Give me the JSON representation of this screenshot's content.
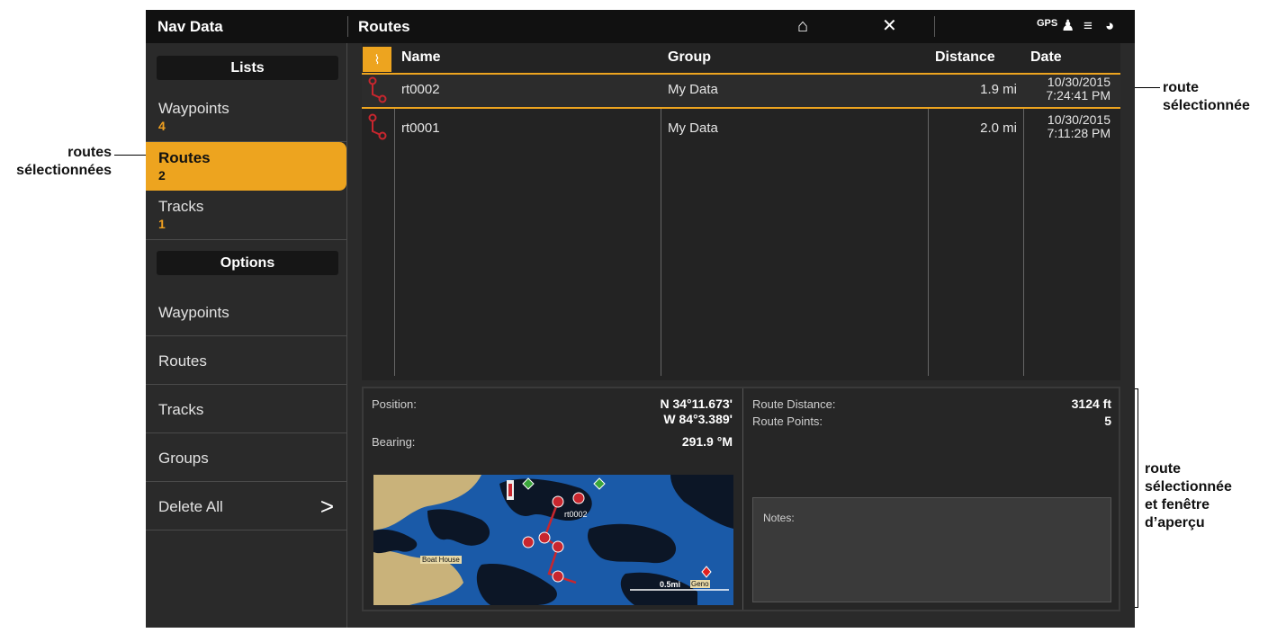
{
  "topbar": {
    "left_title": "Nav Data",
    "center_title": "Routes",
    "gps_label": "GPS"
  },
  "sidebar": {
    "lists_header": "Lists",
    "list_items": [
      {
        "label": "Waypoints",
        "count": "4"
      },
      {
        "label": "Routes",
        "count": "2"
      },
      {
        "label": "Tracks",
        "count": "1"
      }
    ],
    "options_header": "Options",
    "option_items": [
      "Waypoints",
      "Routes",
      "Tracks",
      "Groups"
    ],
    "delete_all": "Delete All",
    "delete_all_chevron": ">"
  },
  "table": {
    "headers": {
      "name": "Name",
      "group": "Group",
      "distance": "Distance",
      "date": "Date"
    },
    "rows": [
      {
        "name": "rt0002",
        "group": "My Data",
        "distance": "1.9 mi",
        "date": "10/30/2015",
        "time": "7:24:41 PM",
        "selected": true
      },
      {
        "name": "rt0001",
        "group": "My Data",
        "distance": "2.0 mi",
        "date": "10/30/2015",
        "time": "7:11:28 PM",
        "selected": false
      }
    ]
  },
  "preview": {
    "position_label": "Position:",
    "position_lat": "N 34°11.673'",
    "position_lon": "W 84°3.389'",
    "bearing_label": "Bearing:",
    "bearing_value": "291.9 °M",
    "route_distance_label": "Route Distance:",
    "route_distance_value": "3124 ft",
    "route_points_label": "Route Points:",
    "route_points_value": "5",
    "notes_label": "Notes:",
    "map_route_label": "rt0002",
    "map_place_label": "Boat House",
    "map_scale_label": "0.5mi",
    "map_cursor_label": "Geno"
  },
  "annotations": {
    "left": "routes\nsélectionnées",
    "route_selected": "route\nsélectionnée",
    "preview": "route\nsélectionnée\net fenêtre\nd’aperçu"
  },
  "colors": {
    "accent": "#eda41f",
    "route_red": "#c8262e",
    "water_blue": "#1a5aa8",
    "land_tan": "#c9b27a"
  }
}
